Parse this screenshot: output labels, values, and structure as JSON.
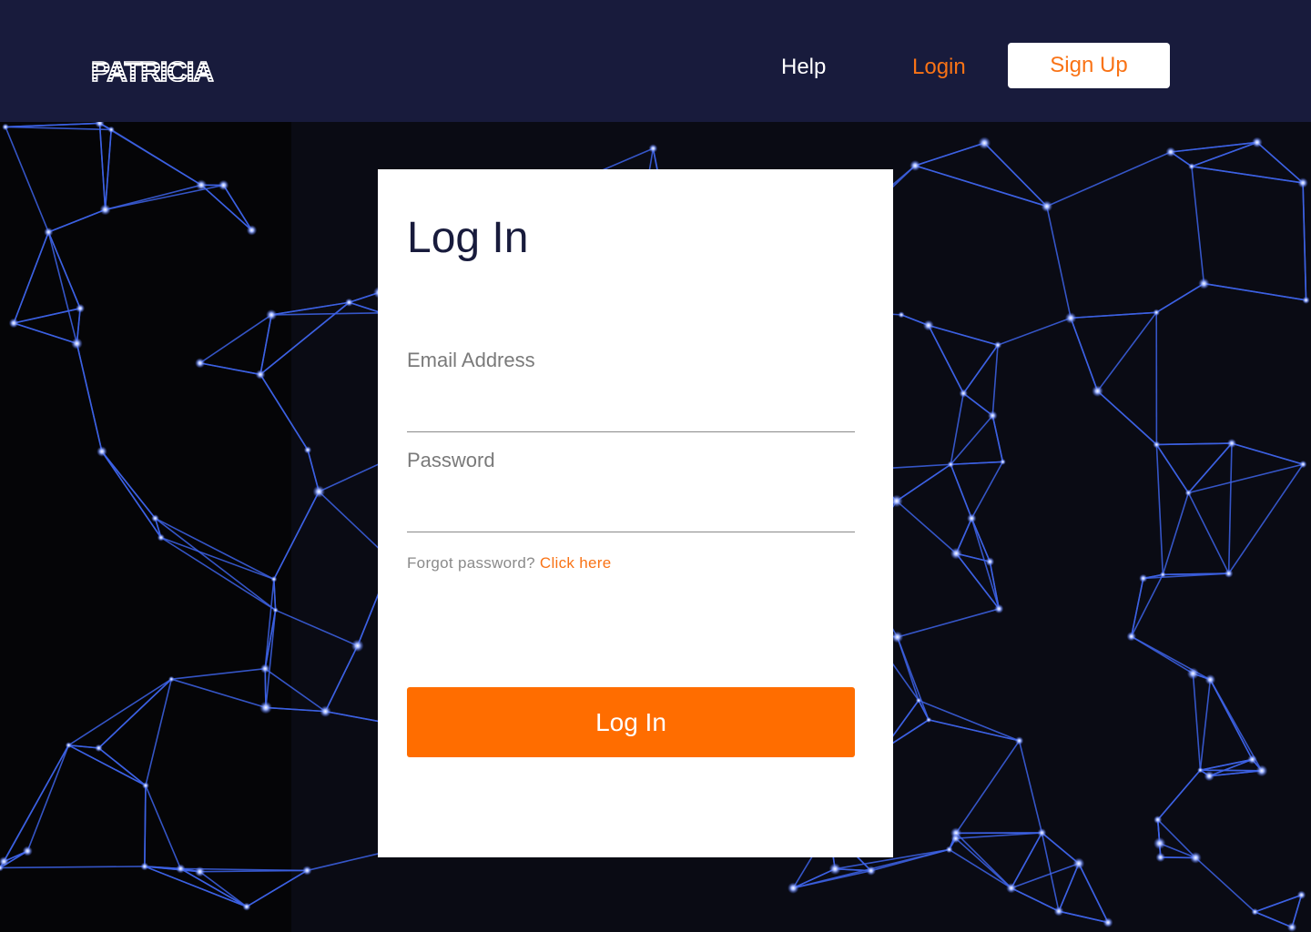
{
  "brand": {
    "logo_text": "PATRICIA"
  },
  "nav": {
    "help_label": "Help",
    "login_label": "Login",
    "signup_label": "Sign Up"
  },
  "form": {
    "title": "Log In",
    "email_label": "Email Address",
    "email_value": "",
    "password_label": "Password",
    "password_value": "",
    "forgot_text": "Forgot password?",
    "forgot_link": "Click here",
    "submit_label": "Log In"
  },
  "colors": {
    "header_bg": "#181b3c",
    "accent": "#ff6d00",
    "link_orange": "#f97316",
    "network_line": "#3b5bdb",
    "page_bg": "#0a0b14"
  }
}
